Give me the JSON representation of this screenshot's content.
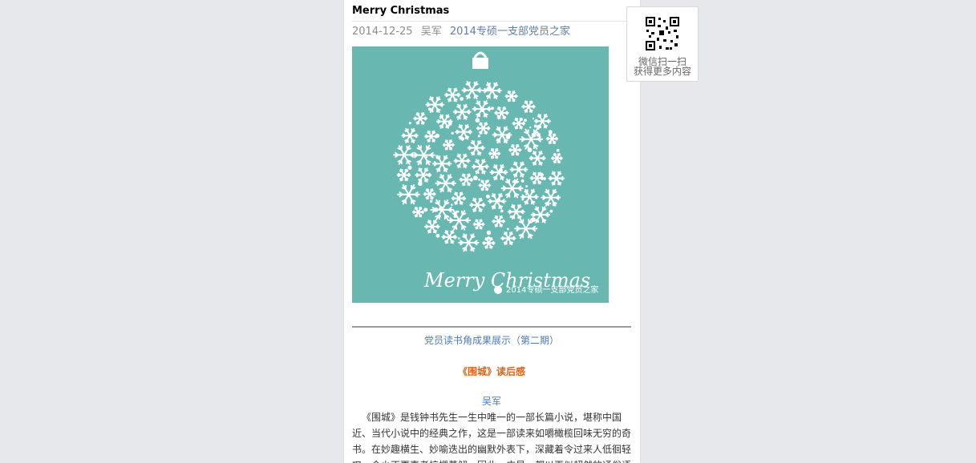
{
  "article": {
    "title": "Merry Christmas",
    "date": "2014-12-25",
    "author": "吴军",
    "account": "2014专硕一支部党员之家",
    "cover": {
      "script_text": "Merry Christmas",
      "watermark": "2014专硕一支部党员之家",
      "background": "#68b8b1"
    },
    "subtitle": "党员读书角成果展示（第二期）",
    "book_title": "《围城》读后感",
    "byline": "吴军",
    "body": "《围城》是钱钟书先生一生中唯一的一部长篇小说，堪称中国近、当代小说中的经典之作，这是一部读来如嚼橄榄回味无穷的奇书。在妙趣横生、妙喻迭出的幽默外表下，深藏着令过来人低徊轻叹，令少不更事者惊愕莫解，因此，广显，都以再似超然的通俗语"
  },
  "qr": {
    "line1": "微信扫一扫",
    "line2": "获得更多内容"
  }
}
